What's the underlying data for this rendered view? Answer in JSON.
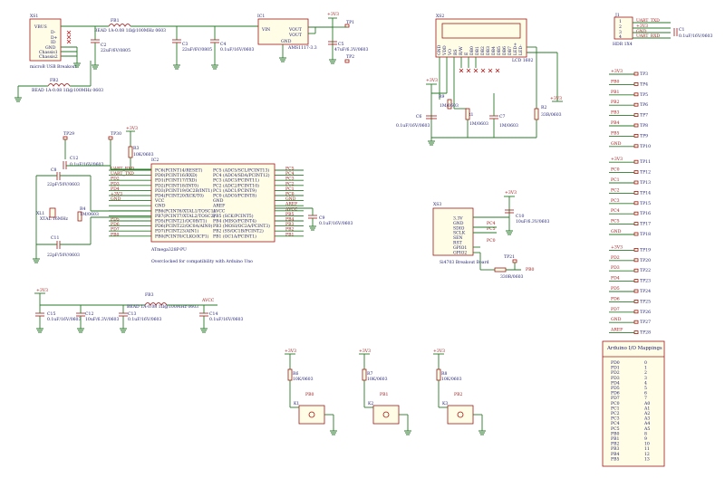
{
  "xs1": {
    "ref": "XS1",
    "pins": [
      "VBUS",
      "D-",
      "D+",
      "ID",
      "GND",
      "Chassis1",
      "Chassis2"
    ],
    "name": "microB USB Breakout"
  },
  "fb1": {
    "ref": "FB1",
    "value": "BEAD 1A-0.08 1Ω@100MHz 0603"
  },
  "fb2": {
    "ref": "FB2",
    "value": "BEAD 1A-0.08 1Ω@100MHz 0603"
  },
  "fb3": {
    "ref": "FB3",
    "value": "BEAD 1A-0.08 1Ω@100MHz 0603"
  },
  "c2": {
    "ref": "C2",
    "value": "22uF/6V/0805"
  },
  "c3": {
    "ref": "C3",
    "value": "22uF/6V/0805"
  },
  "c4": {
    "ref": "C4",
    "value": "0.1uF/16V/0603"
  },
  "c5": {
    "ref": "C5",
    "value": "47uF/6.3V/0603"
  },
  "ic1": {
    "ref": "IC1",
    "pins": [
      "VIN",
      "GND",
      "VOUT",
      "VOUT"
    ],
    "name": "AMS1117-3.3"
  },
  "tp1": "TP1",
  "tp2": "TP2",
  "v33": "+3V3",
  "xs2": {
    "ref": "XS2",
    "pins": [
      "GND",
      "VDD",
      "VO",
      "RS",
      "R/W",
      "E",
      "DB0",
      "DB1",
      "DB2",
      "DB3",
      "DB4",
      "DB5",
      "DB6",
      "DB7",
      "LED+",
      "LED-"
    ],
    "name": "LCD 1602"
  },
  "r9": {
    "ref": "R9",
    "value": "1M/0603"
  },
  "r1": {
    "ref": "R1",
    "value": "1M/0603"
  },
  "r2": {
    "ref": "R2",
    "value": "33R/0603"
  },
  "c6": {
    "ref": "C6",
    "value": "0.1uF/16V/0603"
  },
  "c7": {
    "ref": "C7",
    "value": "1M/0603"
  },
  "xs3": {
    "ref": "XS3",
    "pins": [
      "3.3V",
      "GND",
      "SDIO",
      "SCLK",
      "SEN",
      "RST",
      "GPIO1",
      "GPIO2"
    ],
    "name": "Si4703 Breakout Board",
    "nets": [
      "PC4",
      "PC5",
      "PC0"
    ]
  },
  "c10": {
    "ref": "C10",
    "value": "10uF/6.3V/0603"
  },
  "r5": {
    "ref": "R5",
    "value": "330R/0603"
  },
  "tp21": "TP21",
  "pd3": "PB0",
  "j1": {
    "ref": "J1",
    "pins": [
      "UART_TXD",
      "+3V3",
      "GND",
      "UART_RXD"
    ],
    "name": "HDR 1X4",
    "c1": "C1",
    "c1v": "0.1uF/16V/0603"
  },
  "tps": {
    "labels": [
      "+3V3",
      "PB0",
      "PB1",
      "PB2",
      "PB3",
      "PB4",
      "PB5",
      "GND",
      "+3V3",
      "PC0",
      "PC1",
      "PC2",
      "PC3",
      "PC4",
      "PC5",
      "GND",
      "+3V3",
      "PD2",
      "PD3",
      "PD4",
      "PD5",
      "PD6",
      "PD7",
      "GND",
      "AREF"
    ],
    "names": [
      "TP3",
      "TP4",
      "TP5",
      "TP6",
      "TP7",
      "TP8",
      "TP9",
      "TP10",
      "TP11",
      "TP12",
      "TP13",
      "TP14",
      "TP15",
      "TP16",
      "TP17",
      "TP18",
      "TP19",
      "TP20",
      "TP22",
      "TP23",
      "TP24",
      "TP25",
      "TP26",
      "TP27",
      "TP28"
    ]
  },
  "map": {
    "title": "Arduino I/O Mappings",
    "rows": [
      [
        "PD0",
        "0"
      ],
      [
        "PD1",
        "1"
      ],
      [
        "PD2",
        "2"
      ],
      [
        "PD3",
        "3"
      ],
      [
        "PD4",
        "4"
      ],
      [
        "PD5",
        "5"
      ],
      [
        "PD6",
        "6"
      ],
      [
        "PD7",
        "7"
      ],
      [
        "PC0",
        "A0"
      ],
      [
        "PC1",
        "A1"
      ],
      [
        "PC2",
        "A2"
      ],
      [
        "PC3",
        "A3"
      ],
      [
        "PC4",
        "A4"
      ],
      [
        "PC5",
        "A5"
      ],
      [
        "PB0",
        "8"
      ],
      [
        "PB1",
        "9"
      ],
      [
        "PB2",
        "10"
      ],
      [
        "PB3",
        "11"
      ],
      [
        "PB4",
        "12"
      ],
      [
        "PB5",
        "13"
      ]
    ]
  },
  "ic2": {
    "ref": "IC2",
    "name": "ATmega328P-PU",
    "note": "Overclocked for compatibility with Arduino Uno",
    "left": [
      "PC6(PCINT14/RESET)",
      "PD0(PCINT16/RXD)",
      "PD1(PCINT17/TXD)",
      "PD2(PCINT18/INT0)",
      "PD3(PCINT19/OC2B/INT1)",
      "PD4(PCINT20/XCK/T0)",
      "VCC",
      "GND",
      "PB6(PCINT6/XTAL1/TOSC1)",
      "PB7(PCINT7/XTAL2/TOSC2)",
      "PD5(PCINT21/OC0B/T1)",
      "PD6(PCINT22/OC0A/AIN0)",
      "PD7(PCINT23/AIN1)",
      "PB0(PCINT0/CLKO/ICP1)"
    ],
    "right": [
      "PC5 (ADC5/SCL/PCINT13)",
      "PC4 (ADC4/SDA/PCINT12)",
      "PC3 (ADC3/PCINT11)",
      "PC2 (ADC2/PCINT10)",
      "PC1 (ADC1/PCINT9)",
      "PC0 (ADC0/PCINT8)",
      "GND",
      "AREF",
      "AVCC",
      "PB5 (SCK/PCINT5)",
      "PB4 (MISO/PCINT4)",
      "PB3 (MOSI/OC2A/PCINT3)",
      "PB2 (SS/OC1B/PCINT2)",
      "PB1 (OC1A/PCINT1)"
    ],
    "lnets": [
      "UART_RXD",
      "UART_TXD",
      "PD2",
      "PD3",
      "PD4",
      "+3V3",
      "GND",
      "",
      "",
      "",
      "PD5",
      "PD6",
      "PD7",
      "PB0"
    ],
    "rnets": [
      "PC5",
      "PC4",
      "PC3",
      "PC2",
      "PC1",
      "PC0",
      "GND",
      "AREF",
      "AVCC",
      "PB5",
      "PB4",
      "PB3",
      "PB2",
      "PB1"
    ]
  },
  "tp29": "TP29",
  "tp30": "TP30",
  "r3": {
    "ref": "R3",
    "value": "10K/0603"
  },
  "c8": {
    "ref": "C8",
    "value": "22pF/50V/0603"
  },
  "c11": {
    "ref": "C11",
    "value": "22pF/50V/0603"
  },
  "c9": {
    "ref": "C9",
    "value": "0.1uF/16V/0603"
  },
  "c12": {
    "ref": "C12",
    "value": "0.1uF/16V/0603"
  },
  "xl1": {
    "ref": "XL1",
    "value": "XTAL 16MHz"
  },
  "r4": {
    "ref": "R4",
    "value": "1M/0603"
  },
  "c13": {
    "ref": "C13",
    "value": "10uF/6.3V/0603"
  },
  "c14": {
    "ref": "C14",
    "value": "0.1uF/16V/0603"
  },
  "c15": {
    "ref": "C15",
    "value": "0.1uF/16V/0603"
  },
  "avcc": "AVCC",
  "k1": {
    "ref": "K1",
    "net": "PB0"
  },
  "k2": {
    "ref": "K2",
    "net": "PB1"
  },
  "k3": {
    "ref": "K3",
    "net": "PB2"
  },
  "r6": {
    "ref": "R6",
    "value": "10K/0603"
  },
  "r7": {
    "ref": "R7",
    "value": "10K/0603"
  },
  "r8": {
    "ref": "R8",
    "value": "10K/0603"
  }
}
